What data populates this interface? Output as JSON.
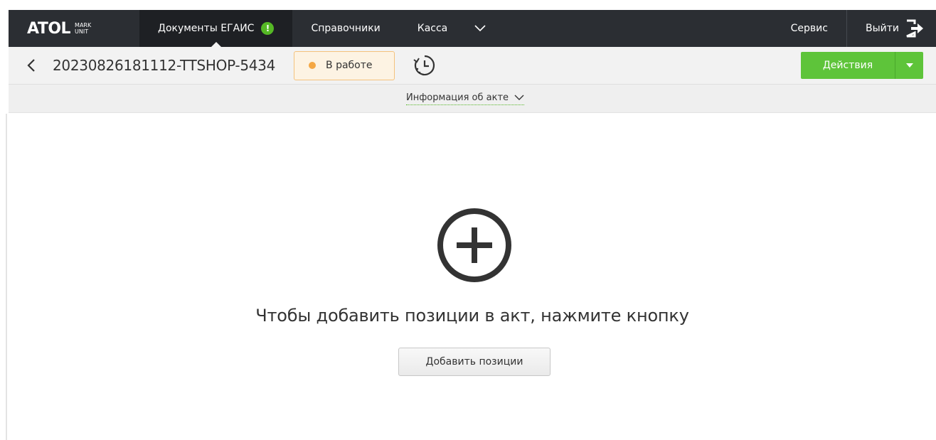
{
  "topbar": {
    "logo_main": "ATOL",
    "logo_sub_1": "MARK",
    "logo_sub_2": "UNIT",
    "nav": [
      {
        "label": "Документы ЕГАИС",
        "badge": "!"
      },
      {
        "label": "Справочники"
      },
      {
        "label": "Касса"
      }
    ],
    "service_label": "Сервис",
    "logout_label": "Выйти"
  },
  "document": {
    "number": "20230826181112-TTSHOP-5434",
    "status": "В работе",
    "actions_label": "Действия"
  },
  "info": {
    "toggle_label": "Информация об акте"
  },
  "empty_state": {
    "message": "Чтобы добавить позиции в акт, нажмите кнопку",
    "button_label": "Добавить позиции"
  },
  "colors": {
    "topbar_bg": "#2b2e33",
    "accent_green": "#5ec43a",
    "status_bg": "#fdf3e3",
    "status_border": "#f4c27d",
    "status_dot": "#f4a744"
  },
  "icons": [
    "back-chevron-icon",
    "history-icon",
    "dropdown-caret-icon",
    "chevron-down-icon",
    "logout-icon",
    "plus-circle-icon",
    "alert-icon"
  ]
}
